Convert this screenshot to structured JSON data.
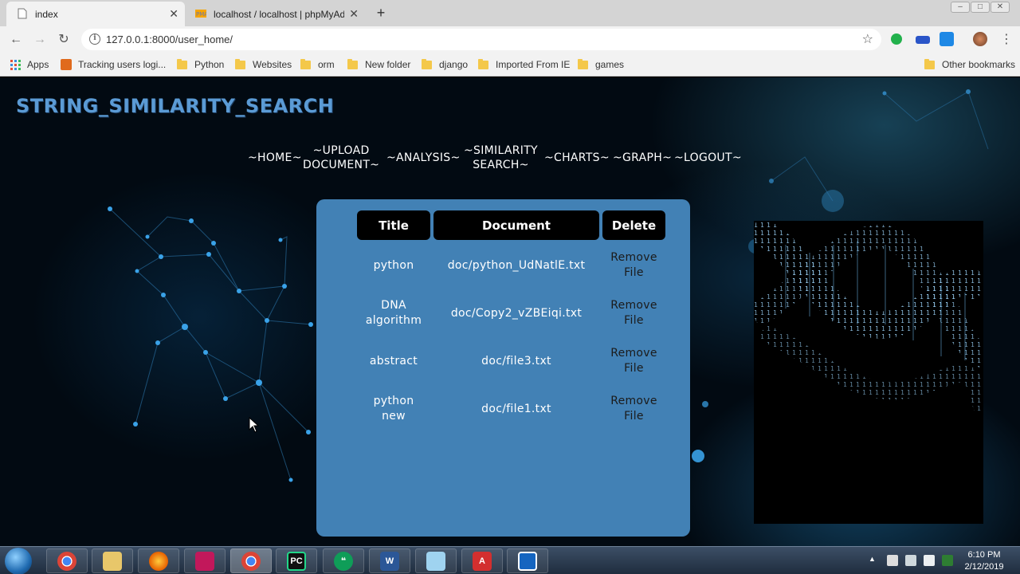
{
  "browser": {
    "tabs": [
      {
        "label": "index",
        "active": true
      },
      {
        "label": "localhost / localhost | phpMyAdr",
        "active": false
      }
    ],
    "url": "127.0.0.1:8000/user_home/",
    "bookmarks": [
      "Apps",
      "Tracking users logi...",
      "Python",
      "Websites",
      "orm",
      "New folder",
      "django",
      "Imported From IE",
      "games"
    ],
    "other_bookmarks": "Other bookmarks"
  },
  "site": {
    "title": "STRING_SIMILARITY_SEARCH",
    "nav": {
      "home": "~HOME~",
      "upload_l1": "~UPLOAD",
      "upload_l2": "DOCUMENT~",
      "analysis": "~ANALYSIS~",
      "similarity_l1": "~SIMILARITY",
      "similarity_l2": "SEARCH~",
      "charts": "~CHARTS~",
      "graph": "~GRAPH~",
      "logout": "~LOGOUT~"
    },
    "table": {
      "headers": {
        "title": "Title",
        "document": "Document",
        "delete": "Delete"
      },
      "rows": [
        {
          "title_l1": "python",
          "title_l2": "",
          "document": "doc/python_UdNatlE.txt",
          "remove_l1": "Remove",
          "remove_l2": "File"
        },
        {
          "title_l1": "DNA",
          "title_l2": "algorithm",
          "document": "doc/Copy2_vZBEiqi.txt",
          "remove_l1": "Remove",
          "remove_l2": "File"
        },
        {
          "title_l1": "abstract",
          "title_l2": "",
          "document": "doc/file3.txt",
          "remove_l1": "Remove",
          "remove_l2": "File"
        },
        {
          "title_l1": "python",
          "title_l2": "new",
          "document": "doc/file1.txt",
          "remove_l1": "Remove",
          "remove_l2": "File"
        }
      ]
    }
  },
  "taskbar": {
    "apps": [
      "chrome-icon",
      "explorer-icon",
      "firefox-icon",
      "winrar-icon",
      "chrome-icon",
      "pycharm-icon",
      "hangouts-icon",
      "word-icon",
      "notepad-icon",
      "acrobat-icon",
      "remote-desktop-icon"
    ],
    "time": "6:10 PM",
    "date": "2/12/2019"
  }
}
